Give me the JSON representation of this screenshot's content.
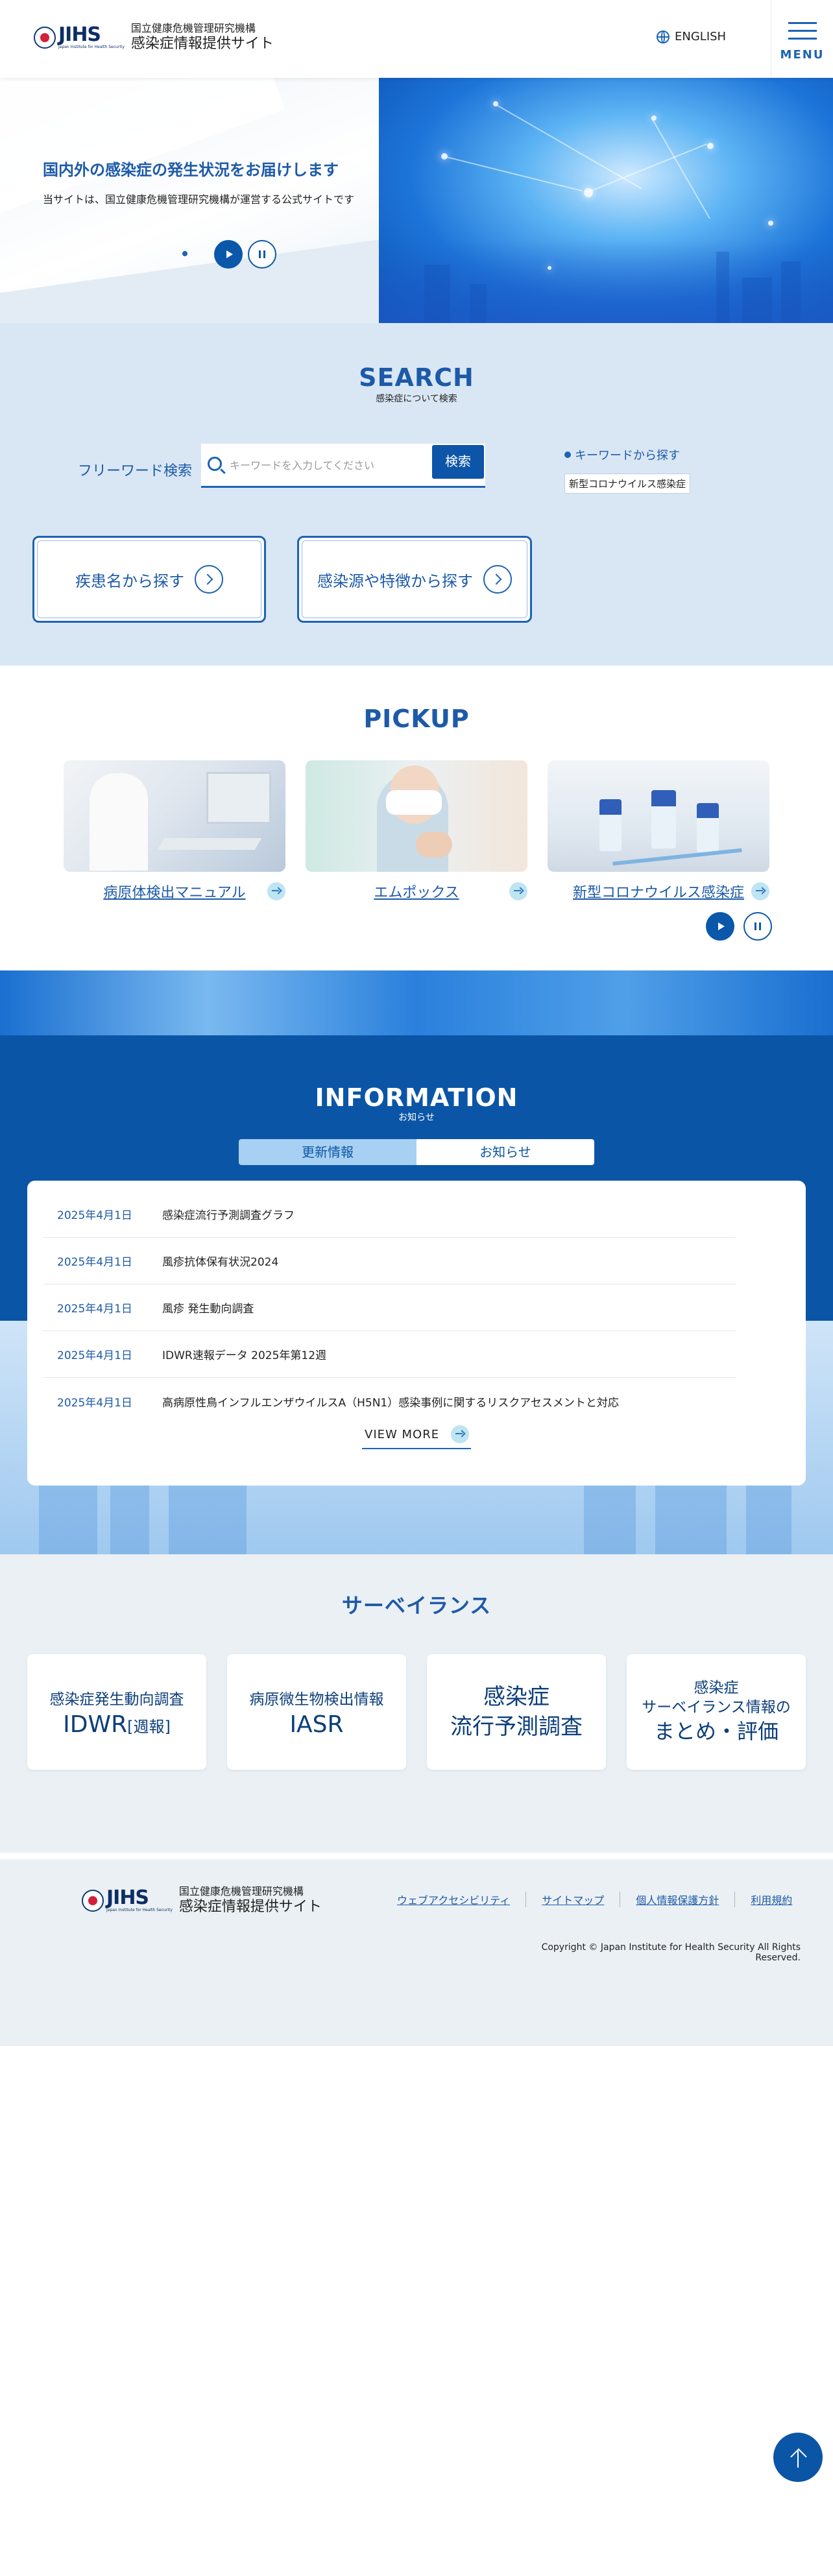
{
  "header": {
    "logo_text": "JIHS",
    "logo_tagline": "Japan Institute for Health Security",
    "org_name": "国立健康危機管理研究機構",
    "site_name": "感染症情報提供サイト",
    "lang_label": "ENGLISH",
    "menu_label": "MENU"
  },
  "hero": {
    "title": "国内外の感染症の発生状況をお届けします",
    "subtitle": "当サイトは、国立健康危機管理研究機構が運営する公式サイトです"
  },
  "search": {
    "heading_en": "SEARCH",
    "heading_ja": "感染症について検索",
    "freeword_label": "フリーワード検索",
    "placeholder": "キーワードを入力してください",
    "button_label": "検索",
    "keyword_heading": "キーワードから探す",
    "keyword_tags": [
      "新型コロナウイルス感染症"
    ],
    "category_buttons": [
      "疾患名から探す",
      "感染源や特徴から探す"
    ]
  },
  "pickup": {
    "heading": "PICKUP",
    "cards": [
      {
        "label": "病原体検出マニュアル"
      },
      {
        "label": "エムポックス"
      },
      {
        "label": "新型コロナウイルス感染症"
      }
    ]
  },
  "information": {
    "heading_en": "INFORMATION",
    "heading_ja": "お知らせ",
    "tabs": [
      "更新情報",
      "お知らせ"
    ],
    "items": [
      {
        "date": "2025年4月1日",
        "title": "感染症流行予測調査グラフ"
      },
      {
        "date": "2025年4月1日",
        "title": "風疹抗体保有状況2024"
      },
      {
        "date": "2025年4月1日",
        "title": "風疹 発生動向調査"
      },
      {
        "date": "2025年4月1日",
        "title": "IDWR速報データ 2025年第12週"
      },
      {
        "date": "2025年4月1日",
        "title": "高病原性鳥インフルエンザウイルスA（H5N1）感染事例に関するリスクアセスメントと対応"
      }
    ],
    "view_more": "VIEW MORE"
  },
  "surveillance": {
    "heading": "サーベイランス",
    "cards": [
      {
        "line1": "感染症発生動向調査",
        "line2": "IDWR",
        "line2_suffix": "[週報]"
      },
      {
        "line1": "病原微生物検出情報",
        "line2": "IASR"
      },
      {
        "line1": "感染症",
        "line2": "流行予測調査"
      },
      {
        "line1": "感染症",
        "line1b": "サーベイランス情報の",
        "line2": "まとめ・評価"
      }
    ]
  },
  "footer": {
    "links": [
      "ウェブアクセシビリティ",
      "サイトマップ",
      "個人情報保護方針",
      "利用規約"
    ],
    "copyright": "Copyright © Japan Institute for Health Security All Rights Reserved."
  },
  "colors": {
    "primary": "#0b55a6",
    "accent": "#1d63b3",
    "search_bg": "#d9e7f4",
    "surveillance_bg": "#ebf0f4"
  }
}
